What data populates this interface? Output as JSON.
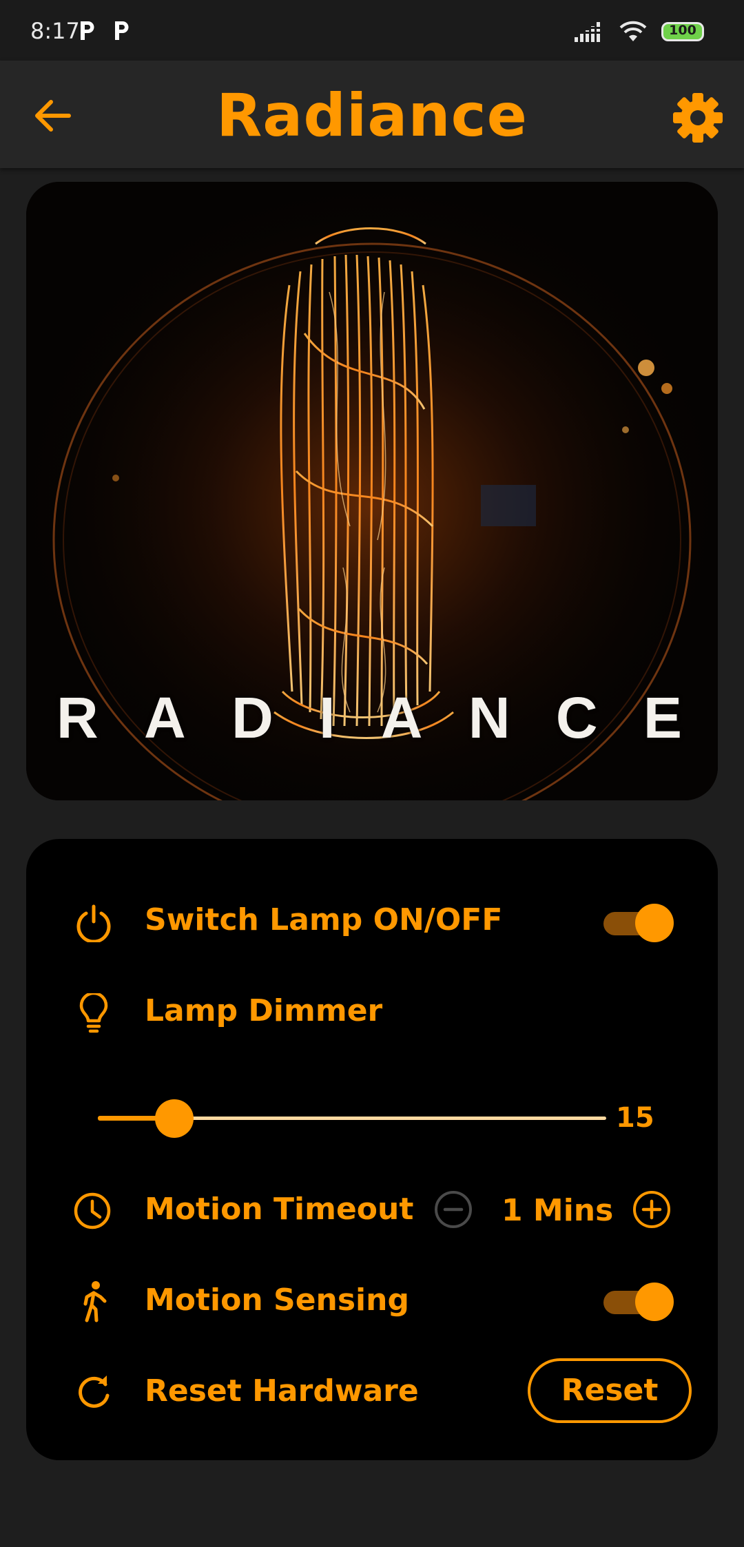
{
  "status_bar": {
    "time": "8:17",
    "battery": "100",
    "notification_icons": [
      "parking-app-icon",
      "parking-app-icon"
    ]
  },
  "app_bar": {
    "title": "Radiance"
  },
  "hero": {
    "letters": [
      "R",
      "A",
      "D",
      "I",
      "A",
      "N",
      "C",
      "E"
    ]
  },
  "controls": {
    "power": {
      "label": "Switch Lamp ON/OFF",
      "on": true
    },
    "dimmer": {
      "label": "Lamp Dimmer",
      "value": "15",
      "min": 0,
      "max": 100
    },
    "timeout": {
      "label": "Motion Timeout",
      "value": "1 Mins"
    },
    "motion": {
      "label": "Motion Sensing",
      "on": true
    },
    "reset": {
      "label": "Reset Hardware",
      "button_label": "Reset"
    }
  },
  "colors": {
    "accent": "#ff9800",
    "background": "#1e1e1e",
    "card": "#000000",
    "toggle_track": "#8a4f08",
    "disabled": "#4a4a4a"
  },
  "icons": {
    "back": "arrow-left-icon",
    "settings": "gear-icon",
    "power": "power-icon",
    "dimmer": "lightbulb-icon",
    "timeout": "clock-icon",
    "decrement": "minus-circle-icon",
    "increment": "plus-circle-icon",
    "motion": "walking-person-icon",
    "reset": "refresh-icon"
  }
}
